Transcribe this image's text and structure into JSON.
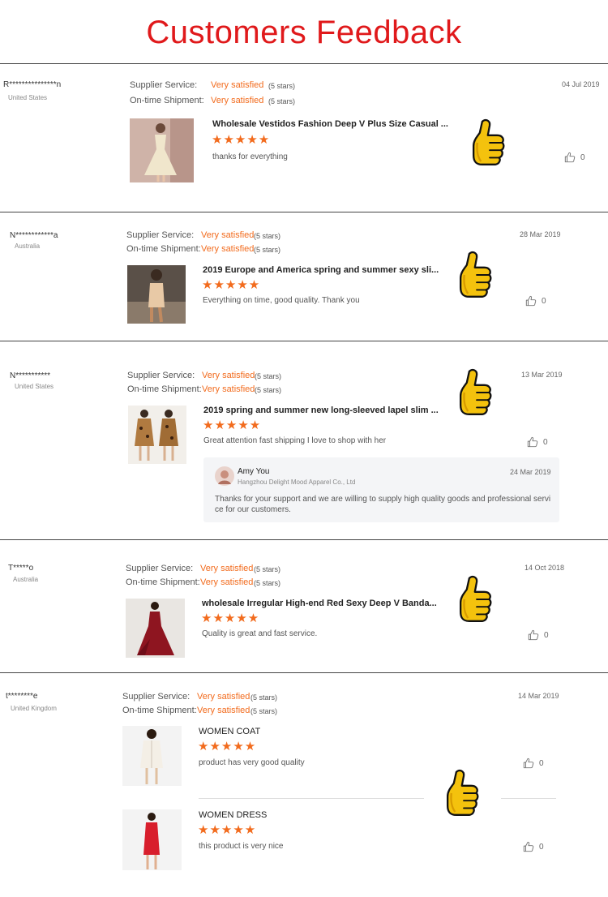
{
  "page": {
    "title": "Customers Feedback"
  },
  "labels": {
    "supplier": "Supplier Service:",
    "shipment": "On-time Shipment:"
  },
  "colors": {
    "title": "#e0191b",
    "accent": "#f26b1d",
    "thumb": "#f4c20d"
  },
  "reviews": [
    {
      "buyer": "R***************n",
      "country": "United States",
      "date": "04 Jul 2019",
      "supplier_rating": "Very satisfied",
      "supplier_stars": "(5 stars)",
      "shipment_rating": "Very satisfied",
      "shipment_stars": "(5 stars)",
      "products": [
        {
          "title": "Wholesale Vestidos Fashion Deep V Plus Size Casual ...",
          "stars": "★★★★★",
          "rating": 5,
          "comment": "thanks for everything",
          "likes": "0"
        }
      ]
    },
    {
      "buyer": "N************a",
      "country": "Australia",
      "date": "28 Mar 2019",
      "supplier_rating": "Very satisfied",
      "supplier_stars": "(5 stars)",
      "shipment_rating": "Very satisfied",
      "shipment_stars": "(5 stars)",
      "products": [
        {
          "title": "2019 Europe and America spring and summer sexy sli...",
          "stars": "★★★★★",
          "rating": 5,
          "comment": "Everything on time, good quality. Thank you",
          "likes": "0"
        }
      ]
    },
    {
      "buyer": "N***********",
      "country": "United States",
      "date": "13 Mar 2019",
      "supplier_rating": "Very satisfied",
      "supplier_stars": "(5 stars)",
      "shipment_rating": "Very satisfied",
      "shipment_stars": "(5 stars)",
      "products": [
        {
          "title": "2019 spring and summer new long-sleeved lapel slim ...",
          "stars": "★★★★★",
          "rating": 5,
          "comment": "Great attention fast shipping I love to shop with her",
          "likes": "0"
        }
      ],
      "reply": {
        "name": "Amy You",
        "company": "Hangzhou Delight Mood Apparel Co., Ltd",
        "date": "24 Mar 2019",
        "line1": "Thanks for your support and we are willing to supply high quality goods and professional servi",
        "line2": "ce for our customers."
      }
    },
    {
      "buyer": "T*****o",
      "country": "Australia",
      "date": "14 Oct 2018",
      "supplier_rating": "Very satisfied",
      "supplier_stars": "(5 stars)",
      "shipment_rating": "Very satisfied",
      "shipment_stars": "(5 stars)",
      "products": [
        {
          "title": "wholesale Irregular High-end Red Sexy Deep V Banda...",
          "stars": "★★★★★",
          "rating": 5,
          "comment": "Quality is great and fast service.",
          "likes": "0"
        }
      ]
    },
    {
      "buyer": "t********e",
      "country": "United Kingdom",
      "date": "14 Mar 2019",
      "supplier_rating": "Very satisfied",
      "supplier_stars": "(5 stars)",
      "shipment_rating": "Very satisfied",
      "shipment_stars": "(5 stars)",
      "products": [
        {
          "title": "WOMEN COAT",
          "stars": "★★★★★",
          "rating": 5,
          "comment": "product has very good quality",
          "likes": "0"
        },
        {
          "title": "WOMEN DRESS",
          "stars": "★★★★★",
          "rating": 5,
          "comment": "this product is very nice",
          "likes": "0"
        }
      ]
    }
  ]
}
